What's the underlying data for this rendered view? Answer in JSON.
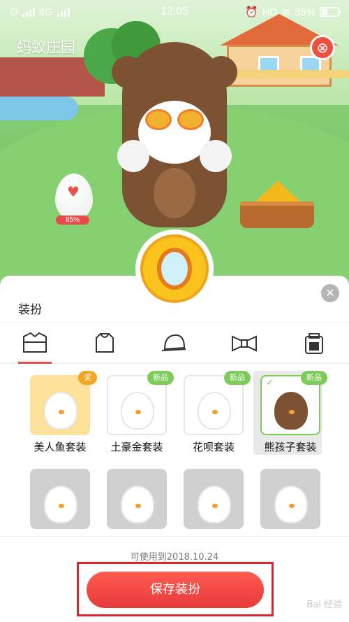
{
  "status_bar": {
    "carrier": "G",
    "network": "4G",
    "time": "12:05",
    "hd": "HD",
    "battery": "35%"
  },
  "scene": {
    "app_title": "蚂蚁庄园",
    "egg_progress": "85%",
    "close_icon": "⊗"
  },
  "panel": {
    "title": "装扮",
    "close_icon": "✕",
    "tabs": [
      {
        "name": "outfit",
        "icon": "shirt-icon"
      },
      {
        "name": "top",
        "icon": "hoodie-icon"
      },
      {
        "name": "hat",
        "icon": "cap-icon"
      },
      {
        "name": "bow",
        "icon": "bowtie-icon"
      },
      {
        "name": "bag",
        "icon": "bag-icon"
      }
    ],
    "items": [
      {
        "label": "美人鱼套装",
        "badge": "奖",
        "badge_type": "award",
        "color": "#f7c52b"
      },
      {
        "label": "土豪金套装",
        "badge": "新品",
        "badge_type": "new",
        "color": "#f4c132"
      },
      {
        "label": "花呗套装",
        "badge": "新品",
        "badge_type": "new",
        "color": "#e95aa8"
      },
      {
        "label": "熊孩子套装",
        "badge": "新品",
        "badge_type": "new",
        "color": "#7d5233"
      },
      {
        "label": "",
        "badge": "",
        "badge_type": "",
        "color": "#d55a3b"
      },
      {
        "label": "",
        "badge": "",
        "badge_type": "",
        "color": "#f2c530"
      },
      {
        "label": "",
        "badge": "",
        "badge_type": "",
        "color": "#8a6a45"
      },
      {
        "label": "",
        "badge": "",
        "badge_type": "",
        "color": "#e9e9e9"
      }
    ]
  },
  "footer": {
    "expiry": "可使用到2018.10.24",
    "save_label": "保存装扮",
    "watermark": "Bai 经验"
  }
}
